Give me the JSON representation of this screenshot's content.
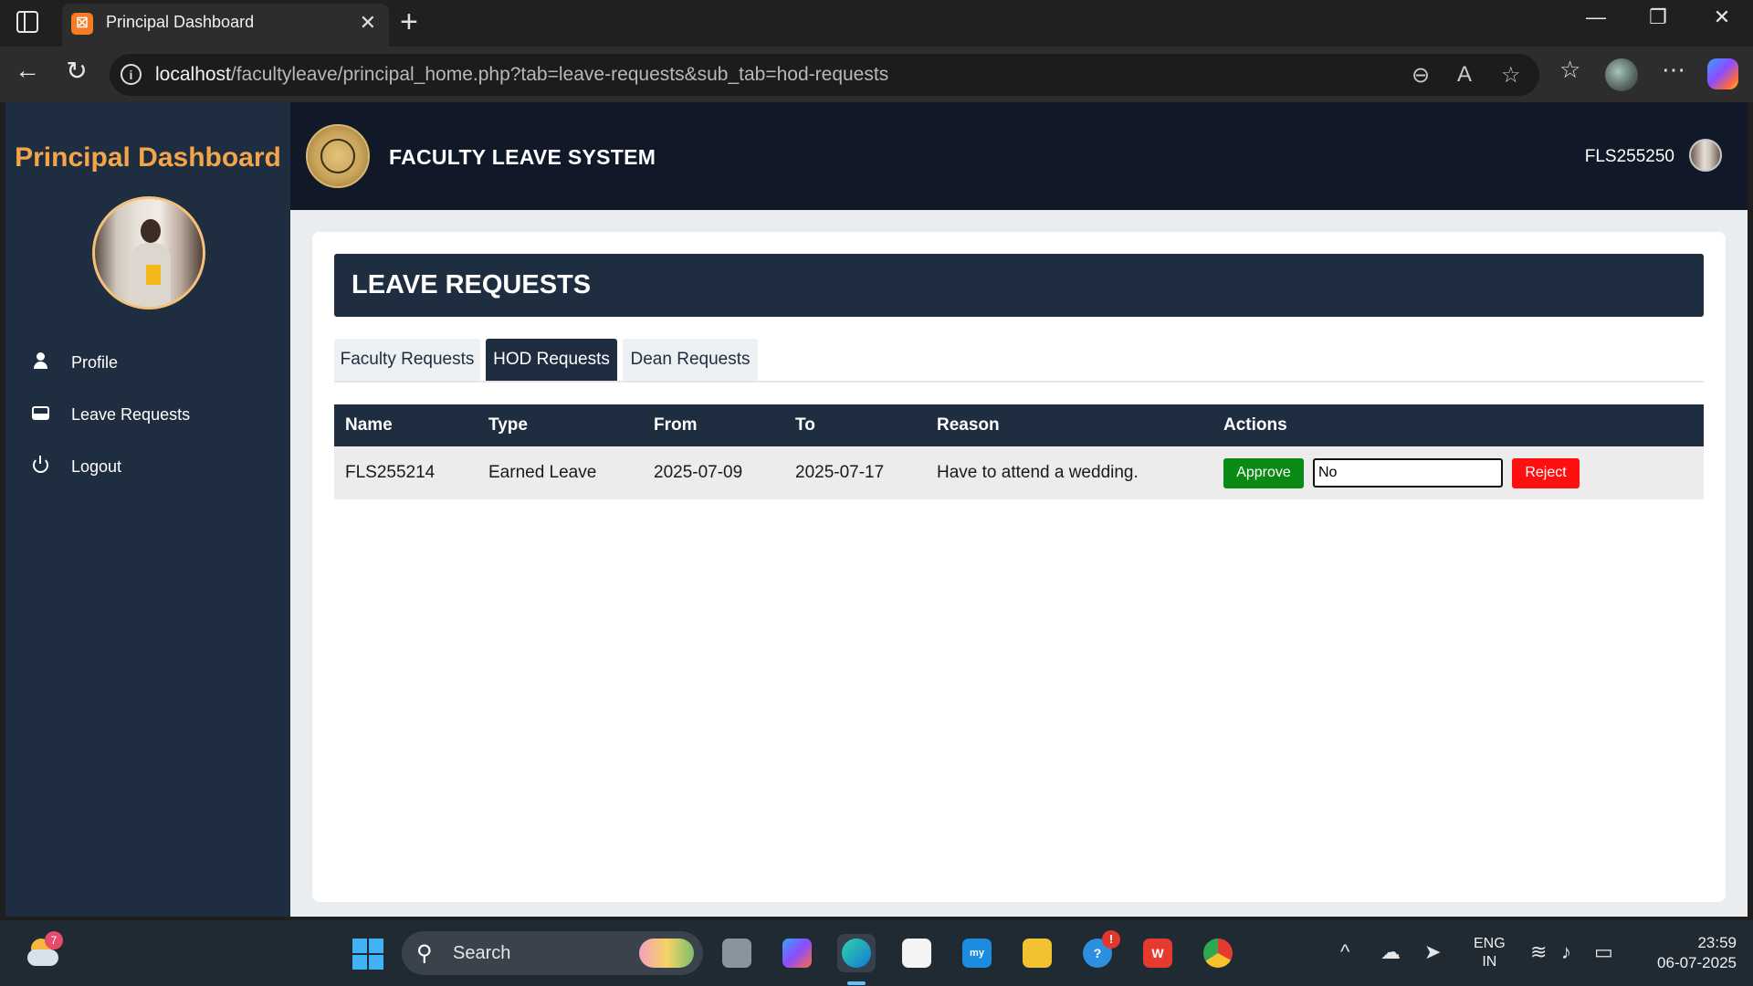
{
  "browser": {
    "tab_title": "Principal Dashboard",
    "tab_favicon": "xampp-icon",
    "url_host": "localhost",
    "url_path": "/facultyleave/principal_home.php?tab=leave-requests&sub_tab=hod-requests"
  },
  "sidebar": {
    "title": "Principal Dashboard",
    "items": [
      {
        "label": "Profile",
        "icon": "user-icon"
      },
      {
        "label": "Leave Requests",
        "icon": "inbox-icon"
      },
      {
        "label": "Logout",
        "icon": "power-icon"
      }
    ]
  },
  "header": {
    "logo_text": "FACULTY LEAVE SYSTEM",
    "brand": "FACULTY LEAVE SYSTEM",
    "user_id": "FLS255250"
  },
  "main": {
    "section_title": "LEAVE REQUESTS",
    "tabs": [
      {
        "label": "Faculty Requests",
        "active": false
      },
      {
        "label": "HOD Requests",
        "active": true
      },
      {
        "label": "Dean Requests",
        "active": false
      }
    ],
    "table": {
      "columns": [
        "Name",
        "Type",
        "From",
        "To",
        "Reason",
        "Actions"
      ],
      "rows": [
        {
          "name": "FLS255214",
          "type": "Earned Leave",
          "from": "2025-07-09",
          "to": "2025-07-17",
          "reason": "Have to attend a wedding.",
          "approve_label": "Approve",
          "reject_reason_value": "No",
          "reject_label": "Reject"
        }
      ]
    }
  },
  "taskbar": {
    "weather_badge": "7",
    "search_label": "Search",
    "help_badge": "!",
    "lang_line1": "ENG",
    "lang_line2": "IN",
    "time": "23:59",
    "date": "06-07-2025"
  },
  "colors": {
    "sidebar_bg": "#1f2d40",
    "topbar_bg": "#111827",
    "sidebar_title": "#f4a54a",
    "approve": "#0a8a15",
    "reject": "#ff1010"
  }
}
